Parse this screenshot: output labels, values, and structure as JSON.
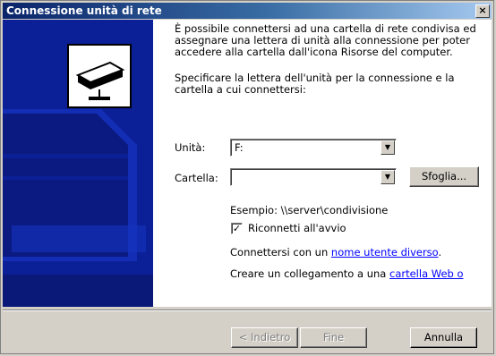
{
  "window": {
    "title": "Connessione unità di rete",
    "close_symbol": "×"
  },
  "intro": {
    "line1": "È possibile connettersi ad una cartella di rete condivisa ed",
    "line2": "assegnare una lettera di unità alla connessione per poter",
    "line3": "accedere alla cartella dall'icona Risorse del computer."
  },
  "instruction": {
    "line1": "Specificare la lettera dell'unità per la connessione e la",
    "line2": "cartella a cui connettersi:"
  },
  "drive": {
    "label": "Unità:",
    "value": "F:"
  },
  "folder": {
    "label": "Cartella:",
    "value": "",
    "browse_label": "Sfoglia..."
  },
  "example": "Esempio: \\\\server\\condivisione",
  "reconnect": {
    "label": "Riconnetti all'avvio",
    "checked": true
  },
  "alt_user": {
    "prefix": "Connettersi con un ",
    "link": "nome utente diverso",
    "suffix": "."
  },
  "web_folder": {
    "prefix": "Creare un collegamento a una ",
    "link": "cartella Web o"
  },
  "buttons": {
    "back": "< Indietro",
    "finish": "Fine",
    "cancel": "Annulla"
  },
  "icons": {
    "side": "network-drive-icon",
    "dropdown": "chevron-down-icon"
  },
  "colors": {
    "titlebar": "#0a246a",
    "side_panel": "#0b1f96",
    "link": "#0000ff"
  }
}
